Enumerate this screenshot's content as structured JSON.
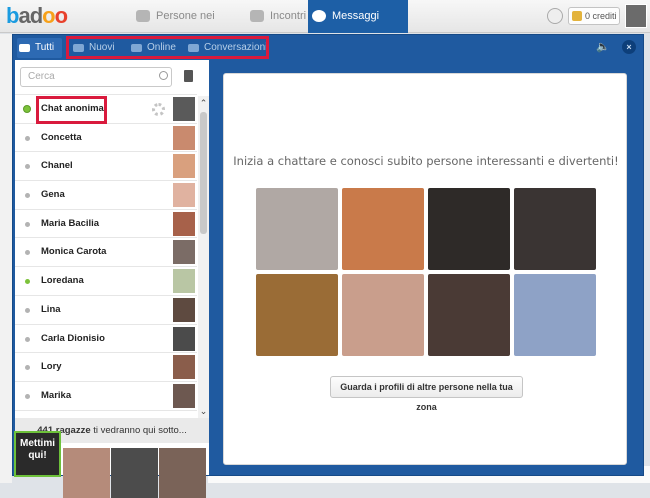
{
  "app": {
    "logo": "badoo"
  },
  "nav": {
    "people_nearby": "Persone nei dintorni",
    "encounters": "Incontri",
    "messages": "Messaggi",
    "credits": "0 crediti"
  },
  "tabs": {
    "all": "Tutti",
    "new": "Nuovi",
    "online": "Online",
    "conversations": "Conversazioni"
  },
  "search": {
    "placeholder": "Cerca"
  },
  "contacts": [
    {
      "name": "Chat anonima",
      "online": true
    },
    {
      "name": "Concetta",
      "online": false
    },
    {
      "name": "Chanel",
      "online": false
    },
    {
      "name": "Gena",
      "online": false
    },
    {
      "name": "Maria Bacilia",
      "online": false
    },
    {
      "name": "Monica Carota",
      "online": false
    },
    {
      "name": "Loredana",
      "online": true
    },
    {
      "name": "Lina",
      "online": false
    },
    {
      "name": "Carla Dionisio",
      "online": false
    },
    {
      "name": "Lory",
      "online": false
    },
    {
      "name": "Marika",
      "online": false
    }
  ],
  "footer": {
    "count": "441 ragazze",
    "text": " ti vedranno qui sotto..."
  },
  "promo": {
    "button": "Mettimi qui!"
  },
  "main": {
    "invite": "Inizia a chattare e conosci subito persone interessanti e divertenti!",
    "cta": "Guarda i profili di altre persone nella tua zona"
  },
  "colors": {
    "accent": "#1f5aa0",
    "online": "#7cc23a",
    "highlight": "#d91a3d"
  }
}
